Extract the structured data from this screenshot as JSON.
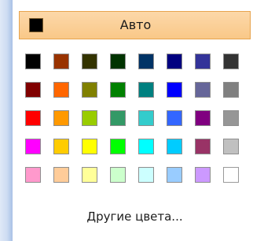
{
  "auto": {
    "label": "Авто",
    "swatch_color": "#000000",
    "highlight_color": "#fbcf95"
  },
  "palette": {
    "rows": [
      [
        "#000000",
        "#993300",
        "#333300",
        "#003300",
        "#003366",
        "#000080",
        "#333399",
        "#333333"
      ],
      [
        "#800000",
        "#ff6600",
        "#808000",
        "#008000",
        "#008080",
        "#0000ff",
        "#666699",
        "#808080"
      ],
      [
        "#ff0000",
        "#ff9900",
        "#99cc00",
        "#339966",
        "#33cccc",
        "#3366ff",
        "#800080",
        "#969696"
      ],
      [
        "#ff00ff",
        "#ffcc00",
        "#ffff00",
        "#00ff00",
        "#00ffff",
        "#00ccff",
        "#993366",
        "#c0c0c0"
      ],
      [
        "#ff99cc",
        "#ffcc99",
        "#ffff99",
        "#ccffcc",
        "#ccffff",
        "#99ccff",
        "#cc99ff",
        "#ffffff"
      ]
    ]
  },
  "more_colors": {
    "label": "Другие цвета..."
  }
}
